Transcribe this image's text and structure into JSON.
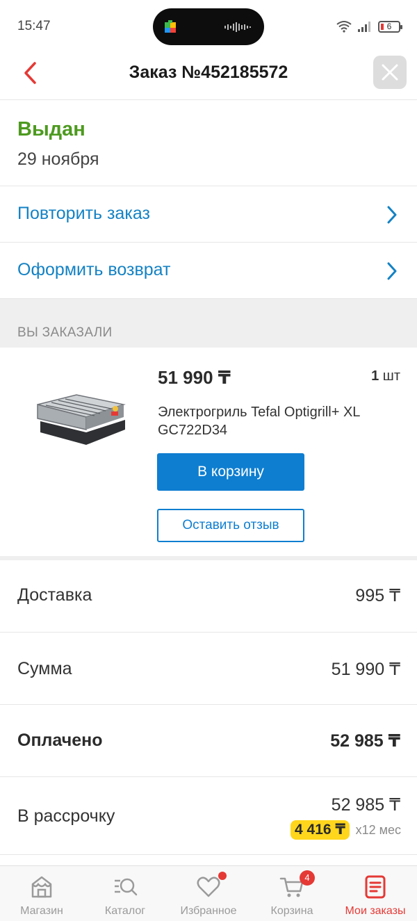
{
  "status_bar": {
    "time": "15:47",
    "battery_level": "6",
    "icons": [
      "google-play-icon",
      "audio-wave-icon",
      "wifi-icon",
      "signal-icon",
      "battery-icon"
    ]
  },
  "header": {
    "title": "Заказ №452185572",
    "back_icon": "chevron-left-icon",
    "close_icon": "close-icon"
  },
  "order": {
    "status": "Выдан",
    "date": "29 ноября"
  },
  "actions": [
    {
      "label": "Повторить заказ",
      "icon": "chevron-right-icon"
    },
    {
      "label": "Оформить возврат",
      "icon": "chevron-right-icon"
    }
  ],
  "ordered_section": {
    "title": "ВЫ ЗАКАЗАЛИ"
  },
  "product": {
    "price": "51 990 ₸",
    "qty_number": "1",
    "qty_unit": "шт",
    "name": "Электрогриль Tefal Optigrill+ XL GC722D34",
    "cart_button": "В корзину",
    "review_button": "Оставить отзыв"
  },
  "summary": {
    "delivery_label": "Доставка",
    "delivery_value": "995 ₸",
    "sum_label": "Сумма",
    "sum_value": "51 990 ₸",
    "paid_label": "Оплачено",
    "paid_value": "52 985 ₸",
    "installment_label": "В рассрочку",
    "installment_total": "52 985 ₸",
    "installment_monthly": "4 416 ₸",
    "installment_months": "x12 мес"
  },
  "bottom_nav": [
    {
      "label": "Магазин",
      "icon": "shop-icon",
      "active": false
    },
    {
      "label": "Каталог",
      "icon": "catalog-search-icon",
      "active": false
    },
    {
      "label": "Избранное",
      "icon": "heart-icon",
      "active": false
    },
    {
      "label": "Корзина",
      "icon": "cart-icon",
      "badge": "4",
      "active": false
    },
    {
      "label": "Мои заказы",
      "icon": "orders-icon",
      "active": true
    }
  ],
  "colors": {
    "accent_blue": "#0e7ed0",
    "link_blue": "#1482c4",
    "status_green": "#4d9a1f",
    "brand_red": "#e53935",
    "installment_yellow": "#ffd61c"
  }
}
